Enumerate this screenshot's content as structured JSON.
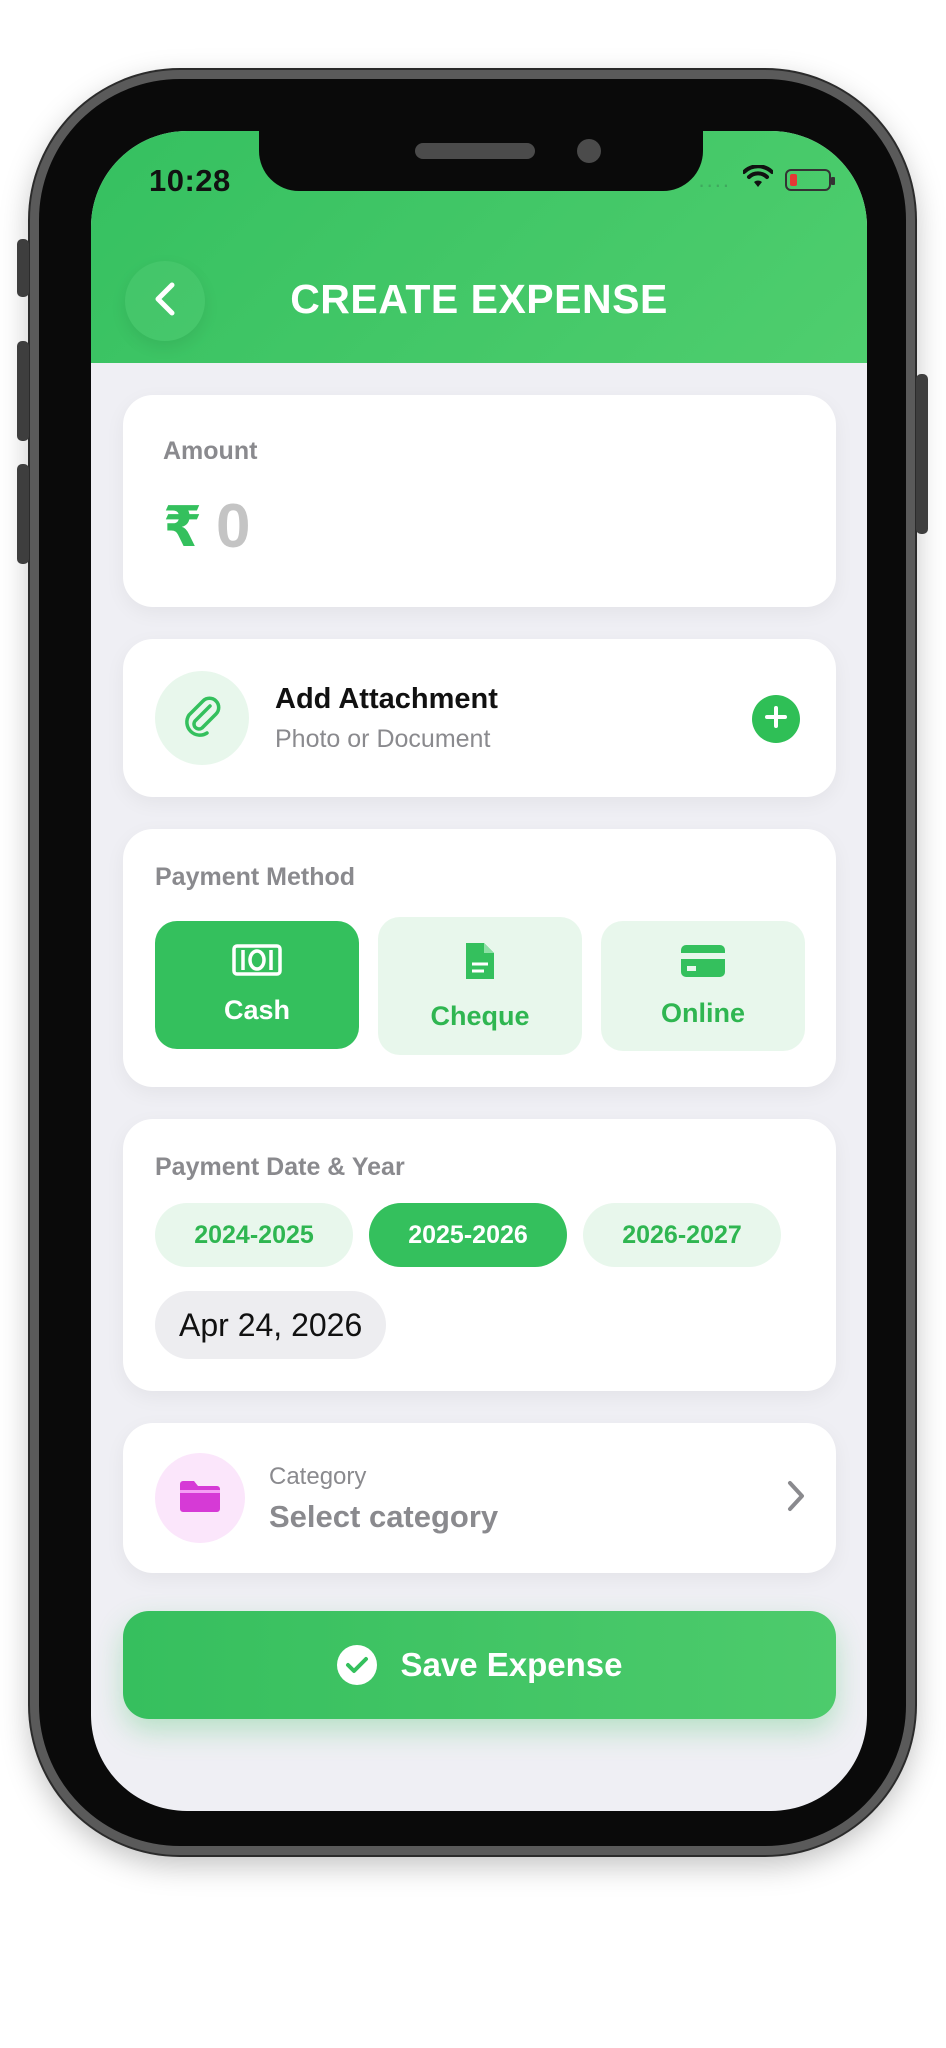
{
  "status_bar": {
    "time": "10:28",
    "signal_dots": "....",
    "battery_color": "#e53935"
  },
  "header": {
    "title": "CREATE EXPENSE",
    "back_icon": "chevron-left-icon",
    "background": "#3cc463"
  },
  "amount": {
    "label": "Amount",
    "currency_symbol": "₹",
    "value": "0"
  },
  "attachment": {
    "title": "Add Attachment",
    "subtitle": "Photo or Document",
    "icon": "paperclip-icon",
    "action_icon": "plus-icon"
  },
  "payment_method": {
    "label": "Payment Method",
    "options": [
      {
        "label": "Cash",
        "icon": "cash-icon",
        "selected": true
      },
      {
        "label": "Cheque",
        "icon": "document-icon",
        "selected": false
      },
      {
        "label": "Online",
        "icon": "credit-card-icon",
        "selected": false
      }
    ]
  },
  "payment_date": {
    "label": "Payment Date & Year",
    "years": [
      {
        "label": "2024-2025",
        "selected": false
      },
      {
        "label": "2025-2026",
        "selected": true
      },
      {
        "label": "2026-2027",
        "selected": false
      }
    ],
    "date": "Apr 24, 2026"
  },
  "category": {
    "label": "Category",
    "value": "Select category",
    "icon": "folder-icon",
    "icon_color": "#d63ad6"
  },
  "save": {
    "label": "Save Expense",
    "icon": "check-circle-icon"
  },
  "colors": {
    "accent": "#34c05d",
    "accent_light": "#e8f7ec",
    "muted_text": "#8a8a8e"
  }
}
